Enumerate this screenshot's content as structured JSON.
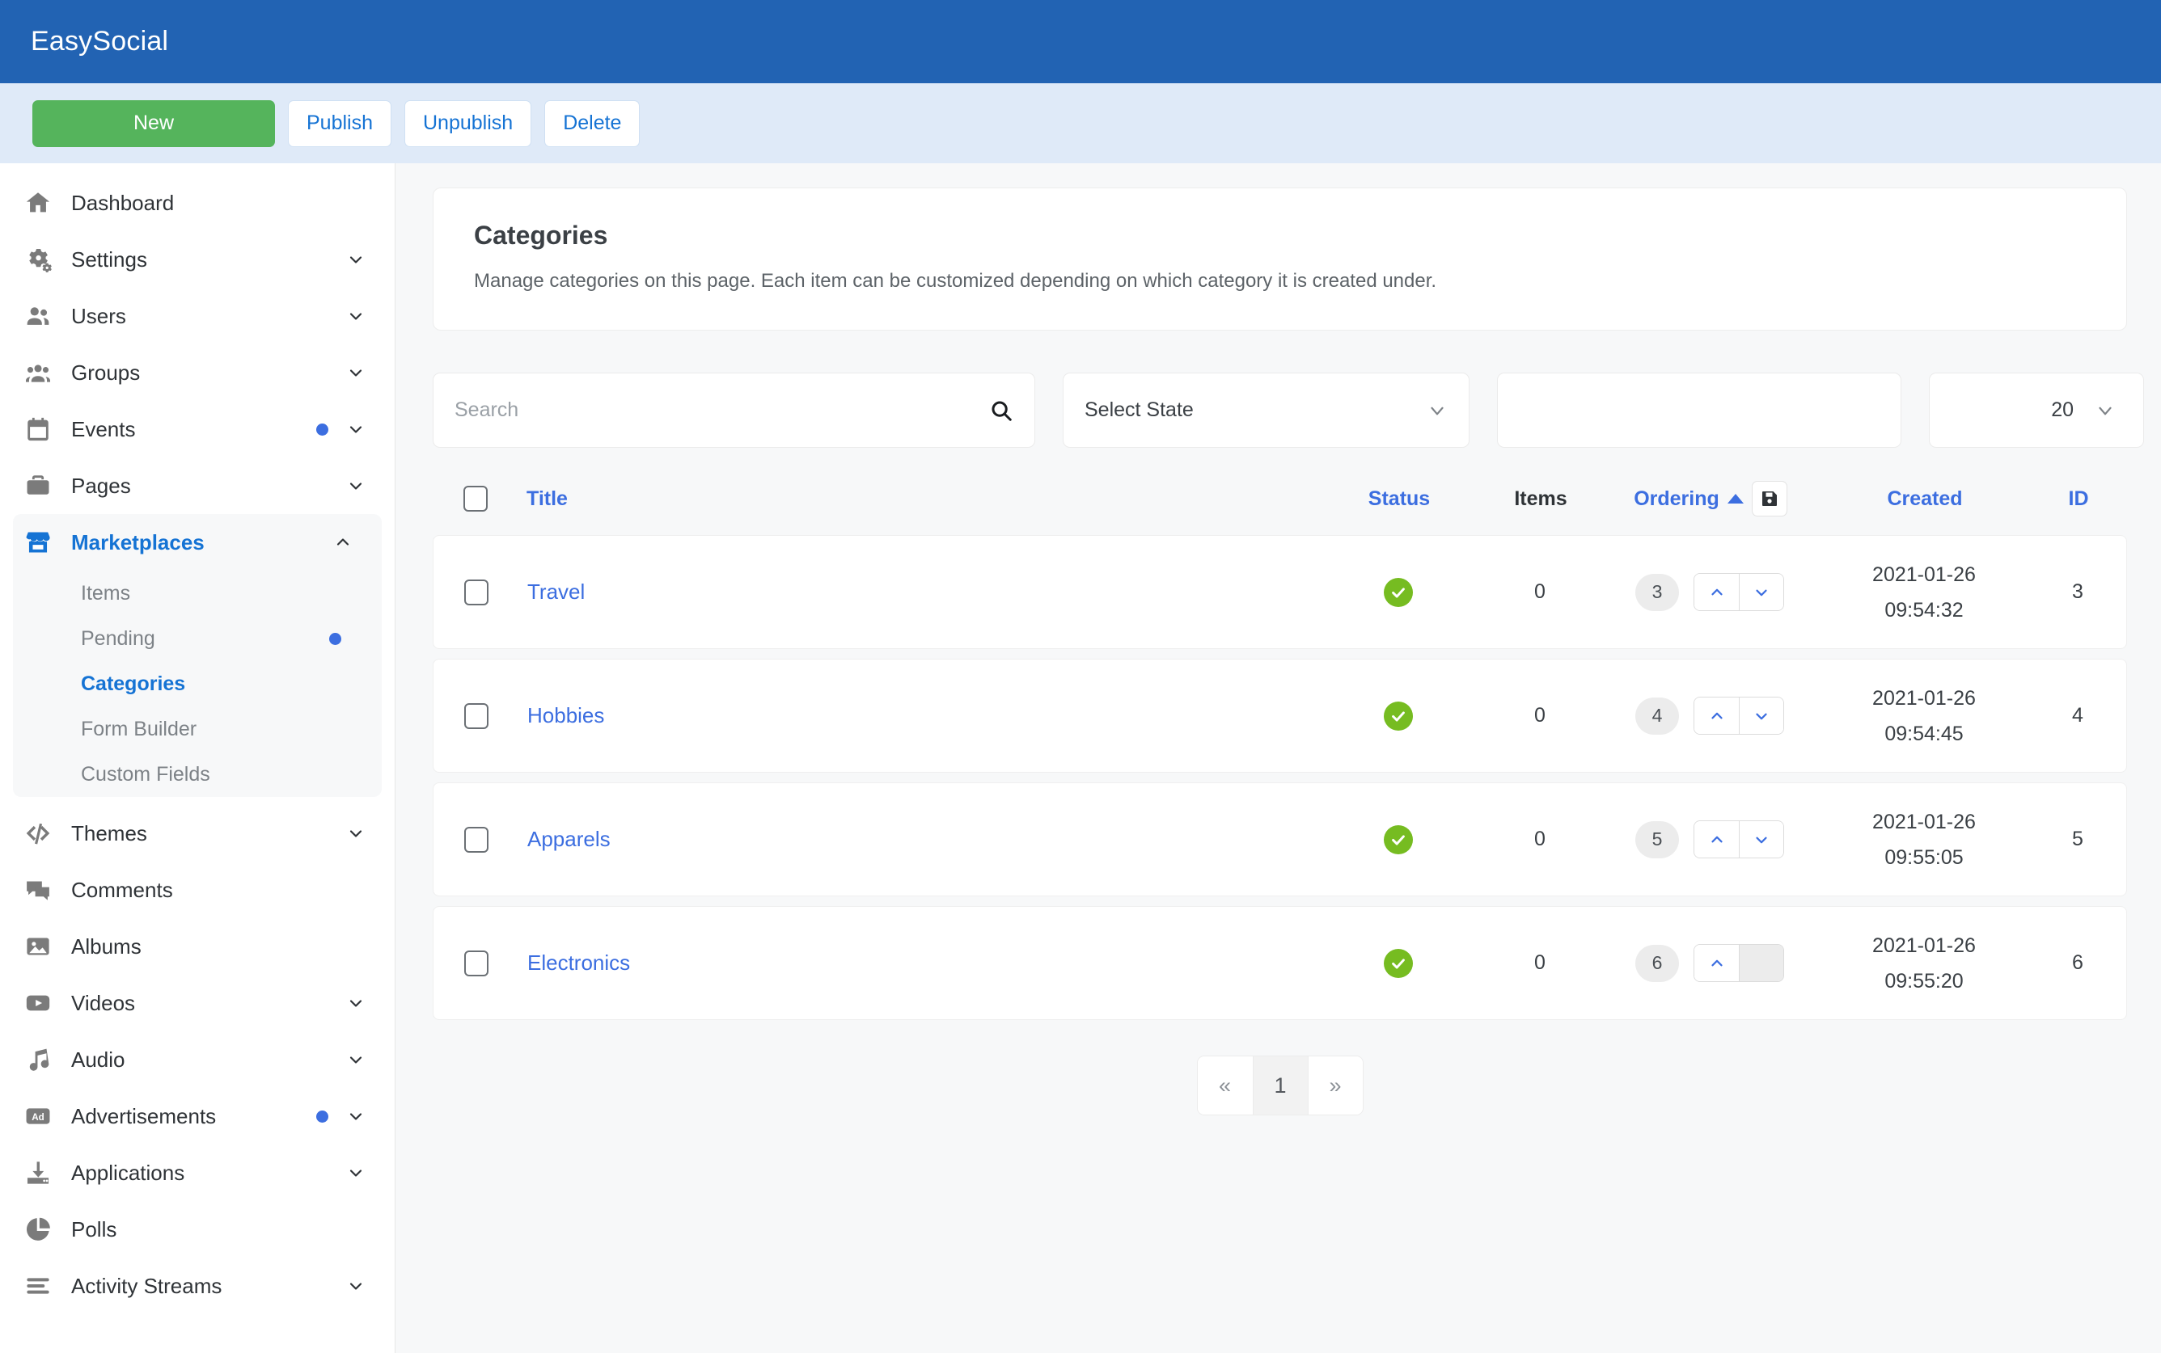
{
  "brand": {
    "title": "EasySocial"
  },
  "toolbar": {
    "new_label": "New",
    "publish_label": "Publish",
    "unpublish_label": "Unpublish",
    "delete_label": "Delete"
  },
  "sidebar": {
    "items": [
      {
        "label": "Dashboard",
        "icon": "home-icon",
        "chevron": "none",
        "dot": false
      },
      {
        "label": "Settings",
        "icon": "gears-icon",
        "chevron": "down",
        "dot": false
      },
      {
        "label": "Users",
        "icon": "users-icon",
        "chevron": "down",
        "dot": false
      },
      {
        "label": "Groups",
        "icon": "groups-icon",
        "chevron": "down",
        "dot": false
      },
      {
        "label": "Events",
        "icon": "calendar-icon",
        "chevron": "down",
        "dot": true
      },
      {
        "label": "Pages",
        "icon": "briefcase-icon",
        "chevron": "down",
        "dot": false
      },
      {
        "label": "Marketplaces",
        "icon": "storefront-icon",
        "chevron": "up",
        "dot": false,
        "active": true
      },
      {
        "label": "Themes",
        "icon": "code-icon",
        "chevron": "down",
        "dot": false
      },
      {
        "label": "Comments",
        "icon": "comments-icon",
        "chevron": "none",
        "dot": false
      },
      {
        "label": "Albums",
        "icon": "image-icon",
        "chevron": "none",
        "dot": false
      },
      {
        "label": "Videos",
        "icon": "video-icon",
        "chevron": "down",
        "dot": false
      },
      {
        "label": "Audio",
        "icon": "music-icon",
        "chevron": "down",
        "dot": false
      },
      {
        "label": "Advertisements",
        "icon": "ad-icon",
        "chevron": "down",
        "dot": true
      },
      {
        "label": "Applications",
        "icon": "download-icon",
        "chevron": "down",
        "dot": false
      },
      {
        "label": "Polls",
        "icon": "pie-chart-icon",
        "chevron": "none",
        "dot": false
      },
      {
        "label": "Activity Streams",
        "icon": "stream-icon",
        "chevron": "down",
        "dot": false
      }
    ],
    "marketplaces_submenu": [
      {
        "label": "Items",
        "dot": false,
        "active": false
      },
      {
        "label": "Pending",
        "dot": true,
        "active": false
      },
      {
        "label": "Categories",
        "dot": false,
        "active": true
      },
      {
        "label": "Form Builder",
        "dot": false,
        "active": false
      },
      {
        "label": "Custom Fields",
        "dot": false,
        "active": false
      }
    ]
  },
  "page": {
    "title": "Categories",
    "description": "Manage categories on this page. Each item can be customized depending on which category it is created under."
  },
  "filters": {
    "search_placeholder": "Search",
    "search_value": "",
    "search_icon": "search-icon",
    "state_label": "Select State",
    "blank_value": "",
    "limit_value": "20"
  },
  "table": {
    "headers": {
      "title": "Title",
      "status": "Status",
      "items": "Items",
      "ordering": "Ordering",
      "created": "Created",
      "id": "ID"
    },
    "sort_direction": "asc",
    "save_order_icon": "save-icon",
    "rows": [
      {
        "title": "Travel",
        "status": "published",
        "items": "0",
        "ordering": "3",
        "created_date": "2021-01-26",
        "created_time": "09:54:32",
        "id": "3",
        "can_move_up": true,
        "can_move_down": true
      },
      {
        "title": "Hobbies",
        "status": "published",
        "items": "0",
        "ordering": "4",
        "created_date": "2021-01-26",
        "created_time": "09:54:45",
        "id": "4",
        "can_move_up": true,
        "can_move_down": true
      },
      {
        "title": "Apparels",
        "status": "published",
        "items": "0",
        "ordering": "5",
        "created_date": "2021-01-26",
        "created_time": "09:55:05",
        "id": "5",
        "can_move_up": true,
        "can_move_down": true
      },
      {
        "title": "Electronics",
        "status": "published",
        "items": "0",
        "ordering": "6",
        "created_date": "2021-01-26",
        "created_time": "09:55:20",
        "id": "6",
        "can_move_up": true,
        "can_move_down": false
      }
    ]
  },
  "pagination": {
    "first_label": "«",
    "last_label": "»",
    "pages": [
      "1"
    ],
    "current": "1"
  },
  "colors": {
    "brand_blue": "#2263b3",
    "toolbar_blue": "#dfeaf8",
    "new_green": "#55b45c",
    "link_blue": "#3c6ee0",
    "status_green": "#76bc21",
    "dot_blue": "#3c6ee0"
  }
}
